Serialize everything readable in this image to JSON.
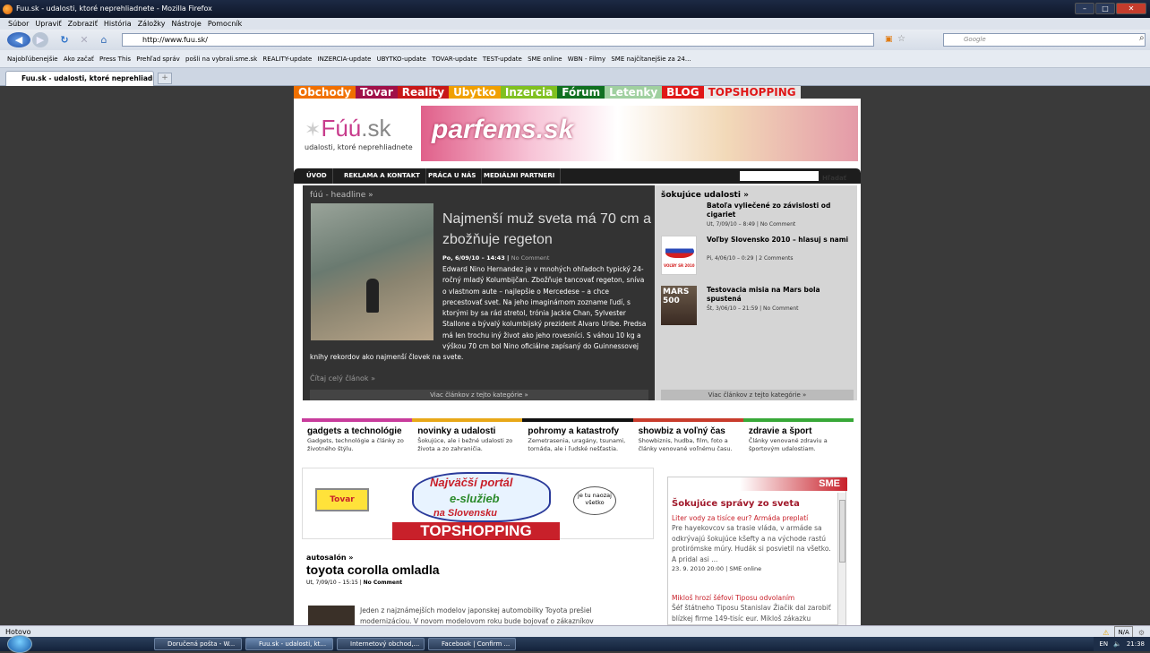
{
  "window": {
    "title": "Fuu.sk - udalosti, ktoré neprehliadnete - Mozilla Firefox"
  },
  "menu": [
    "Súbor",
    "Upraviť",
    "Zobraziť",
    "História",
    "Záložky",
    "Nástroje",
    "Pomocník"
  ],
  "nav": {
    "url": "http://www.fuu.sk/",
    "search_placeholder": "Google"
  },
  "bookmarks": [
    "Najobľúbenejšie",
    "Ako začať",
    "Press This",
    "Prehľad správ",
    "pošli na vybrali.sme.sk",
    "REALITY-update",
    "INZERCIA-update",
    "UBYTKO-update",
    "TOVAR-update",
    "TEST-update",
    "SME online",
    "WBN - Filmy",
    "SME najčítanejšie za 24..."
  ],
  "tab": {
    "label": "Fuu.sk - udalosti, ktoré neprehliadnete",
    "new_tab": "+"
  },
  "site": {
    "topnav": [
      {
        "label": "Obchody",
        "color": "#f07000"
      },
      {
        "label": "Tovar",
        "color": "#a01048"
      },
      {
        "label": "Reality",
        "color": "#c81818"
      },
      {
        "label": "Ubytko",
        "color": "#f0a000"
      },
      {
        "label": "Inzercia",
        "color": "#80c020"
      },
      {
        "label": "Fórum",
        "color": "#107020"
      },
      {
        "label": "Letenky",
        "color": "#a0d0a0"
      },
      {
        "label": "BLOG",
        "color": "#e01818"
      },
      {
        "label": "TOPSHOPPING",
        "color": "#e8e8e8"
      }
    ],
    "logo": {
      "name": "Fúú",
      "tld": ".sk",
      "tagline": "udalosti, ktoré neprehliadnete"
    },
    "banner": {
      "text": "parfems.sk"
    },
    "mainnav": [
      "ÚVOD",
      "REKLAMA A KONTAKT",
      "PRÁCA U NÁS",
      "MEDIÁLNI PARTNERI"
    ],
    "search_button": "Hľadať",
    "headline": {
      "category": "fúú - headline »",
      "title": "Najmenší muž sveta má 70 cm a zbožňuje regeton",
      "date": "Po, 6/09/10 – 14:43",
      "comments": "No Comment",
      "body_wrapped": "Edward Nino Hernandez je v mnohých ohľadoch typický 24-ročný mladý Kolumbijčan. Zbožňuje tancovať regeton, sníva o vlastnom aute – najlepšie o Mercedese – a chce precestovať svet. Na jeho imaginárnom zozname ľudí, s ktorými by sa rád stretol, trónia Jackie Chan, Sylvester Stallone a bývalý kolumbijský prezident Alvaro Uribe. Predsa má len trochu iný život ako jeho rovesníci. S váhou 10 kg a výškou 70 cm bol Nino oficiálne zapísaný do Guinnessovej",
      "body_tail": "knihy rekordov ako najmenší človek na svete.",
      "read_more": "Čítaj celý článok »",
      "more": "Viac článkov z tejto kategórie »"
    },
    "shocking": {
      "title": "šokujúce udalosti »",
      "items": [
        {
          "title": "Batoľa vyliečené zo závislosti od cigariet",
          "meta": "Ut, 7/09/10 – 8:49 | No Comment"
        },
        {
          "title": "Voľby Slovensko 2010 – hlasuj s nami",
          "meta": "Pi, 4/06/10 – 0:29 | 2 Comments",
          "img_text": "VOĽBY SR 2010"
        },
        {
          "title": "Testovacia misia na Mars bola spustená",
          "meta": "Št, 3/06/10 – 21:59 | No Comment",
          "img_text": "MARS 500"
        }
      ],
      "more": "Viac článkov z tejto kategórie »"
    },
    "categories": [
      {
        "title": "gadgets a technológie",
        "desc": "Gadgets, technológie a články zo životného štýlu.",
        "color": "#c83c9c"
      },
      {
        "title": "novinky a udalosti",
        "desc": "Šokujúce, ale i bežné udalosti zo života a zo zahraničia.",
        "color": "#e8a818"
      },
      {
        "title": "pohromy a katastrofy",
        "desc": "Zemetrasenia, uragány, tsunami, tornáda, ale i ľudské nešťastia.",
        "color": "#111111"
      },
      {
        "title": "showbiz a voľný čas",
        "desc": "Showbiznis, hudba, film, foto a články venované voľnému času.",
        "color": "#c83c2c"
      },
      {
        "title": "zdravie a šport",
        "desc": "Články venované zdraviu a športovým udalostiam.",
        "color": "#38a838"
      }
    ],
    "promo": {
      "cloud_line1": "Najväčší portál",
      "cloud_line2": "e-služieb",
      "cloud_line3": "na Slovensku",
      "bar": "TOPSHOPPING",
      "tovar": "Tovar",
      "bubble": "je tu naozaj všetko"
    },
    "auto": {
      "category": "autosalón »",
      "title": "toyota corolla omladla",
      "date": "Ut, 7/09/10 – 15:15",
      "comments": "No Comment",
      "body": "Jeden z najznámejších modelov japonskej automobilky Toyota prešiel modernizáciou. V novom modelovom roku bude bojovať o zákazníkov"
    },
    "sme": {
      "logo": "SME",
      "title": "Šokujúce správy zo sveta",
      "articles": [
        {
          "headline": "Liter vody za tisíce eur? Armáda preplatí",
          "text": "Pre hayekovcov sa trasie vláda, v armáde sa odkrývajú šokujúce kšefty a na východe rastú protirómske múry. Hudák si posvietil na všetko. A pridal asi ...",
          "meta": "23. 9. 2010 20:00 | SME online"
        },
        {
          "headline": "Mikloš hrozí šéfovi Tiposu odvolaním",
          "text": "Šéf štátneho Tiposu Stanislav Žiačik dal zarobiť blízkej firme 149-tisíc eur. Mikloš zákazku preveruje.",
          "meta": ""
        }
      ]
    }
  },
  "status": {
    "text": "Hotovo",
    "right": "N/A"
  },
  "taskbar": {
    "buttons": [
      "Doručená pošta - W...",
      "Fuu.sk - udalosti, kt...",
      "Internetový obchod,...",
      "Facebook | Confirm ..."
    ],
    "lang": "EN",
    "clock": "21:38"
  },
  "colors": {
    "accent": "#c83c8c",
    "sme_red": "#c8202a",
    "dark_box": "#333333"
  }
}
